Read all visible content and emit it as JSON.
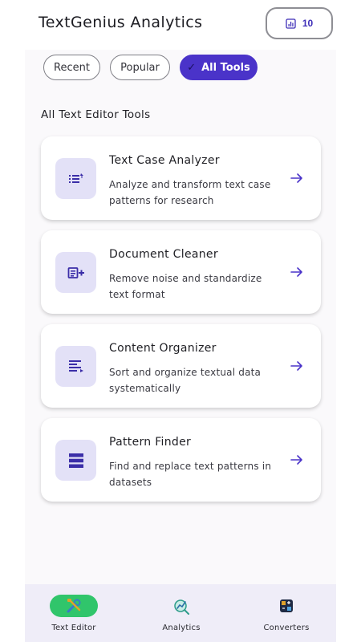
{
  "header": {
    "title": "TextGenius Analytics",
    "count_badge": "10",
    "count_icon": "chart-icon"
  },
  "filters": {
    "items": [
      {
        "label": "Recent",
        "active": false
      },
      {
        "label": "Popular",
        "active": false
      },
      {
        "label": "All Tools",
        "active": true
      }
    ]
  },
  "section": {
    "title": "All Text Editor Tools"
  },
  "tools": [
    {
      "name": "Text Case Analyzer",
      "description": "Analyze and transform text case patterns for research",
      "icon": "sort-list-icon"
    },
    {
      "name": "Document Cleaner",
      "description": "Remove noise and standardize text format",
      "icon": "document-add-icon"
    },
    {
      "name": "Content Organizer",
      "description": "Sort and organize textual data systematically",
      "icon": "align-lines-icon"
    },
    {
      "name": "Pattern Finder",
      "description": "Find and replace text patterns in datasets",
      "icon": "stacked-bars-icon"
    }
  ],
  "bottom_nav": {
    "items": [
      {
        "label": "Text Editor",
        "icon": "tools-icon",
        "active": true
      },
      {
        "label": "Analytics",
        "icon": "analytics-icon",
        "active": false
      },
      {
        "label": "Converters",
        "icon": "converter-icon",
        "active": false
      }
    ]
  },
  "colors": {
    "accent": "#4a33c9",
    "tile": "#e3e1f7",
    "active_nav": "#30c56b",
    "nav_bg": "#efedf8"
  }
}
